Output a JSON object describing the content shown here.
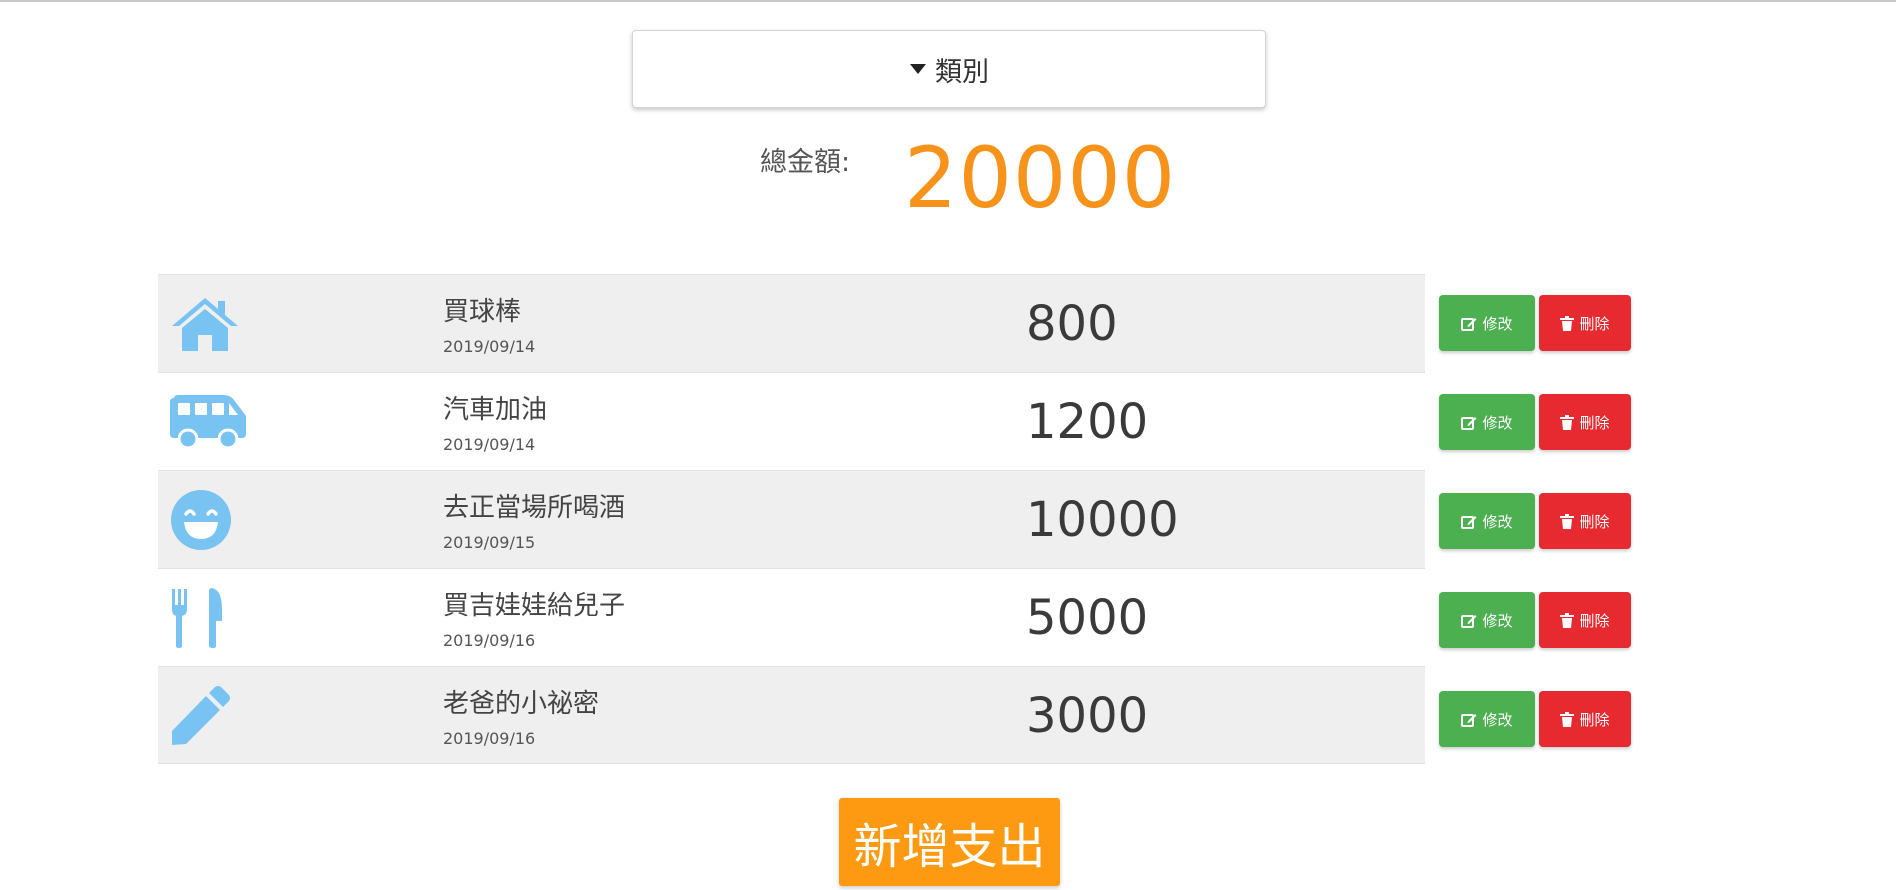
{
  "dropdown": {
    "label": "類別",
    "icon": "caret-down-icon"
  },
  "total": {
    "label": "總金額:",
    "amount": "20000",
    "color": "#f7931a"
  },
  "icon_color": "#79c3f3",
  "expenses": [
    {
      "icon": "home-icon",
      "title": "買球棒",
      "date": "2019/09/14",
      "amount": "800"
    },
    {
      "icon": "bus-icon",
      "title": "汽車加油",
      "date": "2019/09/14",
      "amount": "1200"
    },
    {
      "icon": "smile-icon",
      "title": "去正當場所喝酒",
      "date": "2019/09/15",
      "amount": "10000"
    },
    {
      "icon": "utensils-icon",
      "title": "買吉娃娃給兒子",
      "date": "2019/09/16",
      "amount": "5000"
    },
    {
      "icon": "pencil-icon",
      "title": "老爸的小祕密",
      "date": "2019/09/16",
      "amount": "3000"
    }
  ],
  "actions": {
    "edit_label": "修改",
    "delete_label": "刪除",
    "edit_color": "#4caf50",
    "delete_color": "#e62a30"
  },
  "add_button": {
    "label": "新增支出",
    "color": "#fd9a12"
  }
}
